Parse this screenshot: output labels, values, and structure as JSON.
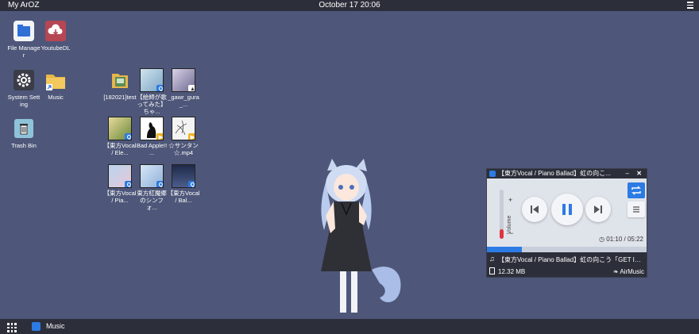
{
  "topbar": {
    "title": "My ArOZ",
    "clock": "October 17 20:06"
  },
  "desktop": {
    "icons": [
      {
        "label": "File Manager"
      },
      {
        "label": "YoutubeDL"
      },
      {
        "label": "System Setting"
      },
      {
        "label": "Music"
      },
      {
        "label": "Trash Bin"
      }
    ],
    "files": [
      {
        "label": "[182021]test"
      },
      {
        "label": "【絵師が歌ってみた】ちゃ..."
      },
      {
        "label": "_gawr_gura_..."
      },
      {
        "label": "【東方Vocal / Ele..."
      },
      {
        "label": "Bad Apple!! ..."
      },
      {
        "label": "☆サンタン☆.mp4"
      },
      {
        "label": "【東方Vocal / Pia..."
      },
      {
        "label": "東方紅魔郷のシンフォ..."
      },
      {
        "label": "【東方Vocal / Bal..."
      }
    ]
  },
  "player": {
    "title": "【東方Vocal / Piano Ballad】虹の向こ...",
    "volume_label": "Volume",
    "volume_fraction": 0.2,
    "time": "01:10 / 05:22",
    "progress_fraction": 0.217,
    "song": "【東方Vocal / Piano Ballad】虹の向こう「GET IN ...",
    "file_size": "12.32 MB",
    "brand": "AirMusic"
  },
  "taskbar": {
    "task_label": "Music"
  },
  "colors": {
    "desktop": "#4e5779",
    "bar": "#2c2f3a",
    "accent": "#2c7be5"
  }
}
